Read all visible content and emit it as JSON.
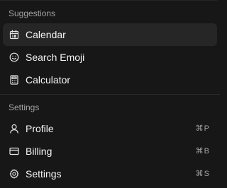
{
  "suggestions": {
    "heading": "Suggestions",
    "items": [
      {
        "label": "Calendar",
        "icon": "calendar-icon",
        "selected": true
      },
      {
        "label": "Search Emoji",
        "icon": "smile-icon",
        "selected": false
      },
      {
        "label": "Calculator",
        "icon": "calculator-icon",
        "selected": false
      }
    ]
  },
  "settings": {
    "heading": "Settings",
    "items": [
      {
        "label": "Profile",
        "icon": "user-icon",
        "shortcut": "⌘P"
      },
      {
        "label": "Billing",
        "icon": "credit-card-icon",
        "shortcut": "⌘B"
      },
      {
        "label": "Settings",
        "icon": "settings-icon",
        "shortcut": "⌘S"
      }
    ]
  },
  "colors": {
    "background": "#171717",
    "selected_item": "#262626",
    "text": "#f5f5f5",
    "muted_text": "#a3a3a3"
  }
}
